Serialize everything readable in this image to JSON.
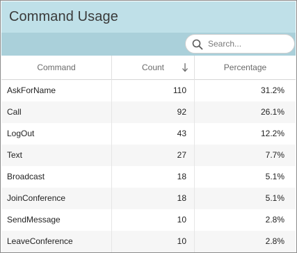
{
  "panel": {
    "title": "Command Usage"
  },
  "search": {
    "placeholder": "Search...",
    "value": ""
  },
  "table": {
    "columns": [
      {
        "label": "Command"
      },
      {
        "label": "Count",
        "sort": "descending"
      },
      {
        "label": "Percentage"
      }
    ],
    "rows": [
      {
        "command": "AskForName",
        "count": "110",
        "percentage": "31.2%"
      },
      {
        "command": "Call",
        "count": "92",
        "percentage": "26.1%"
      },
      {
        "command": "LogOut",
        "count": "43",
        "percentage": "12.2%"
      },
      {
        "command": "Text",
        "count": "27",
        "percentage": "7.7%"
      },
      {
        "command": "Broadcast",
        "count": "18",
        "percentage": "5.1%"
      },
      {
        "command": "JoinConference",
        "count": "18",
        "percentage": "5.1%"
      },
      {
        "command": "SendMessage",
        "count": "10",
        "percentage": "2.8%"
      },
      {
        "command": "LeaveConference",
        "count": "10",
        "percentage": "2.8%"
      }
    ]
  },
  "icons": {
    "search": "search-icon",
    "sort": "arrow-down-icon"
  },
  "colors": {
    "title_bar": "#bfe0e8",
    "search_bar": "#aad0da",
    "alt_row": "#f6f6f6"
  }
}
